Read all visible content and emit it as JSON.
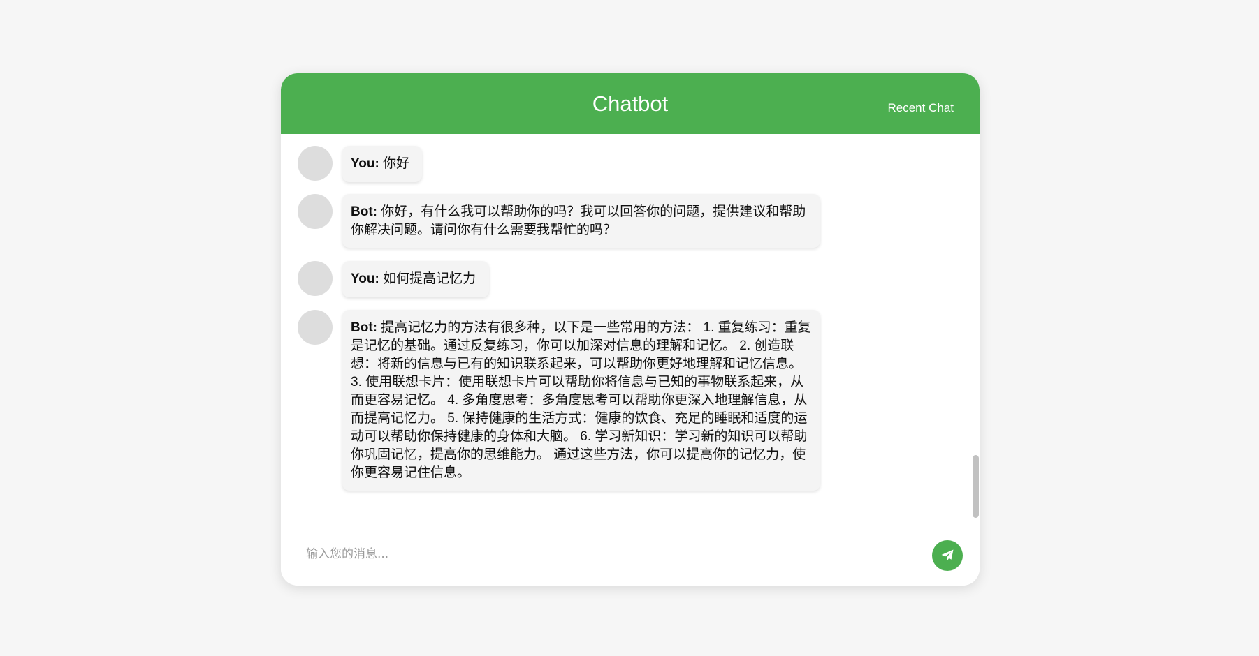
{
  "header": {
    "title": "Chatbot",
    "recent_chat_label": "Recent Chat"
  },
  "messages": [
    {
      "sender": "You:",
      "text": "你好"
    },
    {
      "sender": "Bot:",
      "text": "你好，有什么我可以帮助你的吗？我可以回答你的问题，提供建议和帮助你解决问题。请问你有什么需要我帮忙的吗？"
    },
    {
      "sender": "You:",
      "text": "如何提高记忆力"
    },
    {
      "sender": "Bot:",
      "text": "提高记忆力的方法有很多种，以下是一些常用的方法： 1. 重复练习：重复是记忆的基础。通过反复练习，你可以加深对信息的理解和记忆。 2. 创造联想：将新的信息与已有的知识联系起来，可以帮助你更好地理解和记忆信息。 3. 使用联想卡片：使用联想卡片可以帮助你将信息与已知的事物联系起来，从而更容易记忆。 4. 多角度思考：多角度思考可以帮助你更深入地理解信息，从而提高记忆力。 5. 保持健康的生活方式：健康的饮食、充足的睡眠和适度的运动可以帮助你保持健康的身体和大脑。 6. 学习新知识：学习新的知识可以帮助你巩固记忆，提高你的思维能力。 通过这些方法，你可以提高你的记忆力，使你更容易记住信息。"
    }
  ],
  "input": {
    "placeholder": "输入您的消息...",
    "value": ""
  },
  "icons": {
    "send": "send-icon"
  },
  "colors": {
    "accent": "#4caf50",
    "page_background": "#f6f6f6",
    "bubble_background": "#f4f4f4",
    "avatar": "#dddddd"
  }
}
